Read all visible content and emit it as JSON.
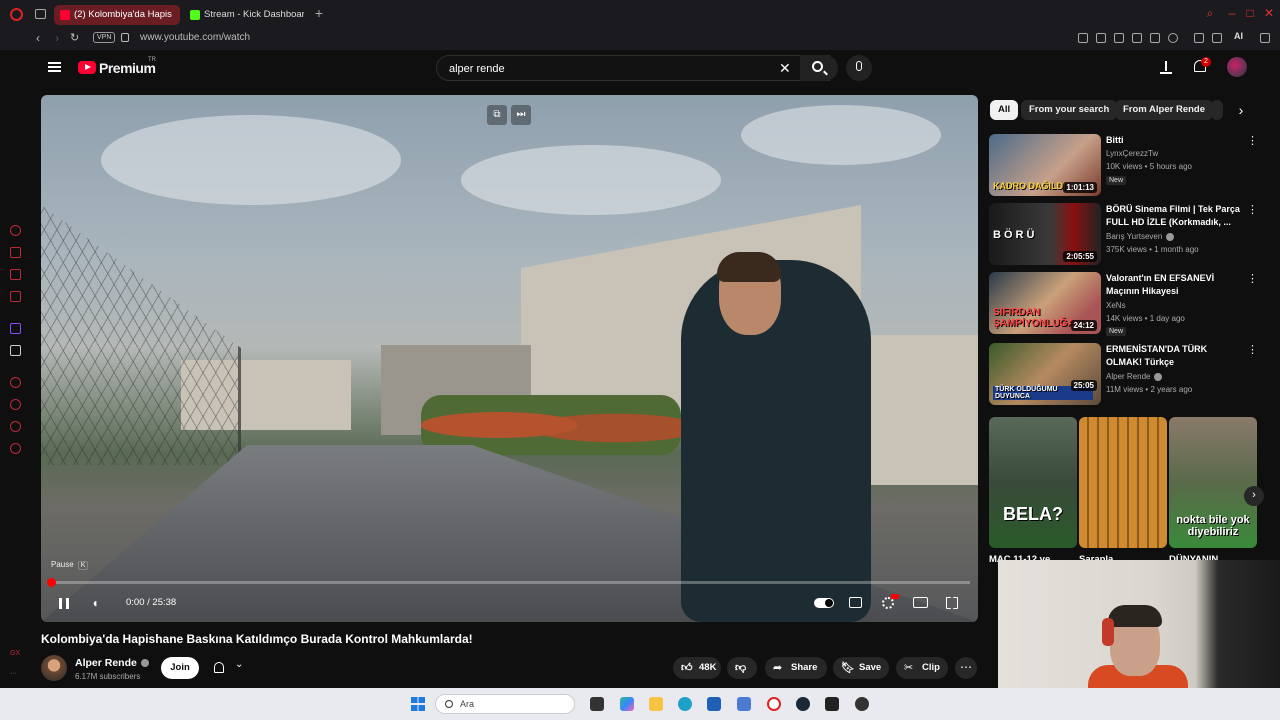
{
  "browser": {
    "tabs": [
      {
        "label": "(2) Kolombiya'da Hapis",
        "active": true,
        "favicon": "youtube-icon"
      },
      {
        "label": "Stream - Kick Dashboard",
        "active": false,
        "favicon": "kick-icon"
      }
    ],
    "vpn_label": "VPN",
    "url": "www.youtube.com/watch",
    "ai_label": "AI"
  },
  "youtube": {
    "brand": "Premium",
    "country": "TR",
    "search_query": "alper rende",
    "notification_count": "2"
  },
  "player": {
    "tooltip": "Pause",
    "tooltip_key": "K",
    "time": "0:00 / 25:38",
    "progress_fraction": 0.0
  },
  "video": {
    "title": "Kolombiya'da Hapishane Baskına Katıldımço Burada Kontrol Mahkumlarda!",
    "channel": "Alper Rende",
    "subscribers": "6.17M subscribers",
    "join_label": "Join",
    "likes": "48K",
    "share_label": "Share",
    "save_label": "Save",
    "clip_label": "Clip"
  },
  "chips": [
    "All",
    "From your search",
    "From Alper Rende"
  ],
  "recommendations": [
    {
      "title": "Bitti",
      "channel": "LynxÇerezzTw",
      "meta": "10K views • 5 hours ago",
      "duration": "1:01:13",
      "badge": "New",
      "thumb_text": "KADRO DAĞILDI"
    },
    {
      "title": "BÖRÜ Sinema Filmi | Tek Parça FULL HD İZLE (Korkmadık, ...",
      "channel": "Barış Yurtseven",
      "meta": "375K views • 1 month ago",
      "duration": "2:05:55",
      "badge": "",
      "thumb_text": "BÖRÜ"
    },
    {
      "title": "Valorant'ın EN EFSANEVİ Maçının Hikayesi",
      "channel": "XeNs",
      "meta": "14K views • 1 day ago",
      "duration": "24:12",
      "badge": "New",
      "thumb_text": "SIFIRDAN ŞAMPİYONLUĞA"
    },
    {
      "title": "ERMENİSTAN'DA TÜRK OLMAK! Türkçe konuştuğumuzu duyan ...",
      "channel": "Alper Rende",
      "meta": "11M views • 2 years ago",
      "duration": "25:05",
      "badge": "",
      "thumb_text": "TÜRK OLDUĞUMU DUYUNCA"
    }
  ],
  "shorts": [
    {
      "thumb_text": "BELA?",
      "label": "MAÇ 11-12 ve"
    },
    {
      "thumb_text": "",
      "label": "Sarapla"
    },
    {
      "thumb_text": "nokta bile yok diyebiliriz",
      "label": "DÜNYANIN"
    }
  ],
  "taskbar": {
    "search_placeholder": "Ara"
  },
  "colors": {
    "yt_red": "#ff0033",
    "opera_red": "#c0283a",
    "bg": "#0f0f0f"
  }
}
